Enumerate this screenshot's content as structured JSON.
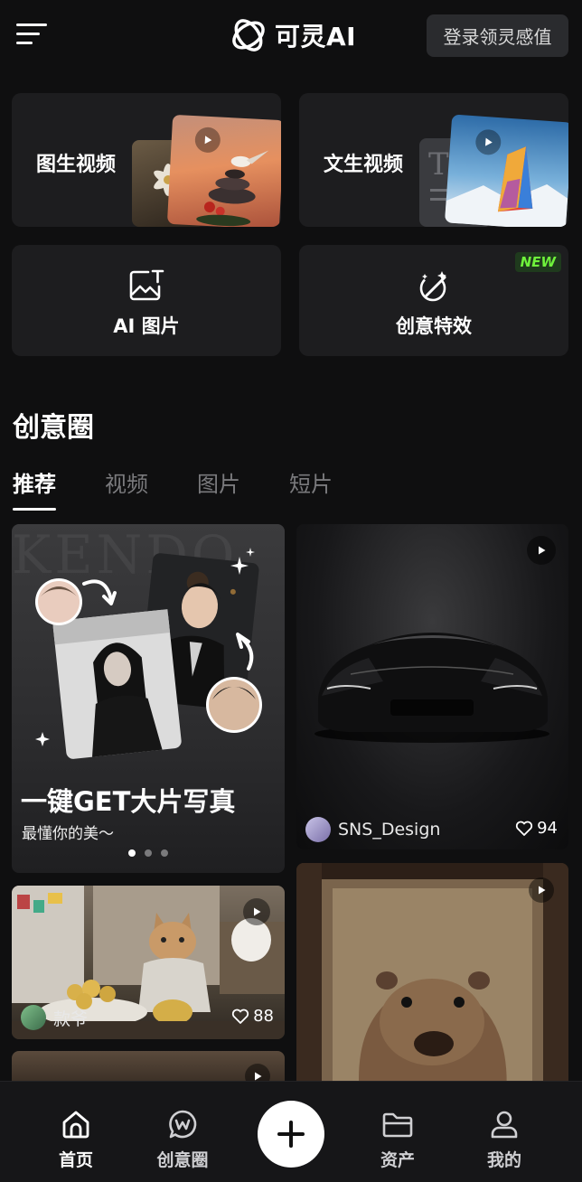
{
  "header": {
    "logo_text": "可灵AI",
    "login_label": "登录领灵感值"
  },
  "tools": {
    "image_to_video": "图生视频",
    "text_to_video": "文生视频",
    "ai_image": "AI 图片",
    "creative_effects": "创意特效",
    "new_badge": "NEW"
  },
  "community": {
    "title": "创意圈",
    "tabs": [
      {
        "label": "推荐",
        "active": true
      },
      {
        "label": "视频",
        "active": false
      },
      {
        "label": "图片",
        "active": false
      },
      {
        "label": "短片",
        "active": false
      }
    ]
  },
  "feed": {
    "banner": {
      "watermark": "KENDO",
      "headline": "一键GET大片写真",
      "subline": "最懂你的美～"
    },
    "car_post": {
      "author": "SNS_Design",
      "likes": "94"
    },
    "cat_post": {
      "author": "款爷",
      "likes": "88"
    }
  },
  "bottom_nav": {
    "home": "首页",
    "community": "创意圈",
    "assets": "资产",
    "me": "我的"
  },
  "colors": {
    "background": "#0f0f10",
    "card": "#1d1d1f",
    "new_badge": "#6ff23b"
  }
}
